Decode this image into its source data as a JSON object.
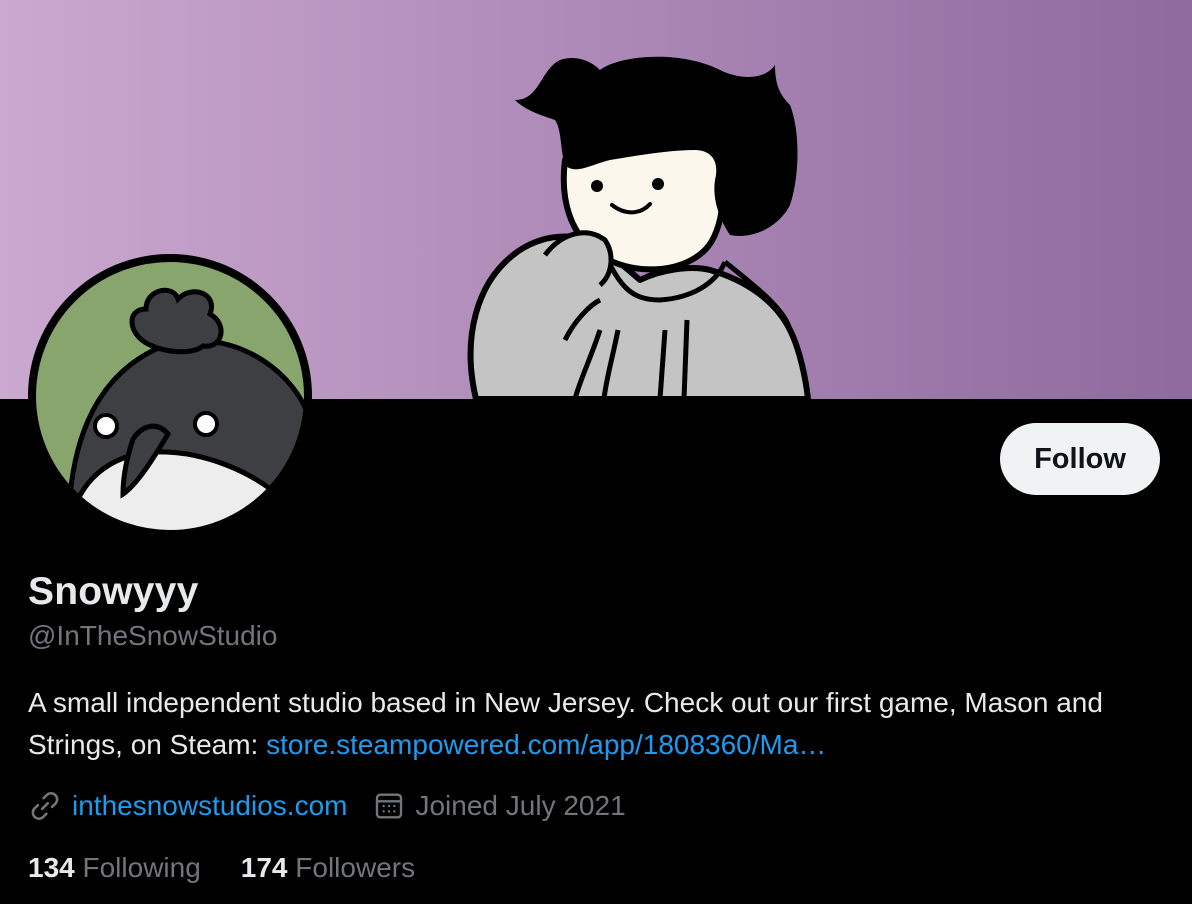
{
  "profile": {
    "display_name": "Snowyyy",
    "handle": "@InTheSnowStudio",
    "bio_text": "A small independent studio based in New Jersey. Check out our first game, Mason and Strings, on Steam: ",
    "bio_link": "store.steampowered.com/app/1808360/Ma…",
    "website": "inthesnowstudios.com",
    "joined": "Joined July 2021",
    "follow_label": "Follow"
  },
  "stats": {
    "following_count": "134",
    "following_label": "Following",
    "followers_count": "174",
    "followers_label": "Followers"
  },
  "icons": {
    "website": "link-icon",
    "joined": "calendar-icon"
  },
  "colors": {
    "background": "#000000",
    "text_primary": "#e7e9ea",
    "text_secondary": "#71767b",
    "link": "#1d9bf0",
    "follow_button_bg": "#eff3f4",
    "banner_gradient_start": "#cba8cf",
    "banner_gradient_end": "#8e6a9e",
    "avatar_bg": "#87a56c"
  }
}
